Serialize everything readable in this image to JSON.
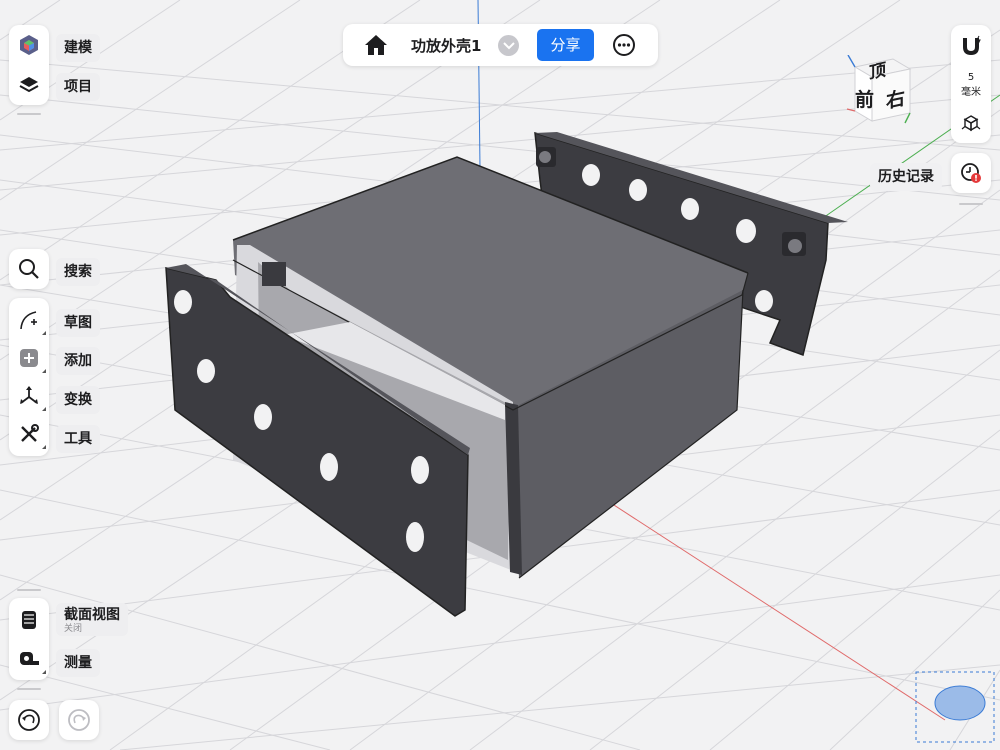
{
  "document": {
    "title": "功放外壳1",
    "share_label": "分享"
  },
  "sidebar_top": {
    "items": [
      {
        "label": "建模",
        "icon": "model-workspace-icon"
      },
      {
        "label": "项目",
        "icon": "layers-icon"
      }
    ]
  },
  "sidebar_tools": {
    "search": {
      "label": "搜索",
      "icon": "magnifier-icon"
    },
    "items": [
      {
        "label": "草图",
        "icon": "sketch-icon"
      },
      {
        "label": "添加",
        "icon": "add-icon"
      },
      {
        "label": "变换",
        "icon": "transform-icon"
      },
      {
        "label": "工具",
        "icon": "tools-icon"
      }
    ]
  },
  "sidebar_bottom": {
    "section_view": {
      "label": "截面视图",
      "status": "关闭",
      "icon": "section-view-icon"
    },
    "measure": {
      "label": "测量",
      "icon": "tape-measure-icon"
    }
  },
  "history": {
    "undo_icon": "undo-icon",
    "redo_icon": "redo-icon"
  },
  "right_panel": {
    "snap_icon": "magnet-icon",
    "snap_value": "5",
    "snap_unit": "毫米",
    "grid_icon": "cube-grid-icon",
    "history_label": "历史记录",
    "history_icon": "history-clock-icon"
  },
  "view_cube": {
    "top": "顶",
    "front": "前",
    "right": "右"
  },
  "colors": {
    "accent": "#1a73f0",
    "viewport_bg": "#f2f2f3",
    "grid": "#d8d8dc",
    "axis_y": "#3a7bd5",
    "axis_x": "#e06a6a",
    "axis_z": "#4caf50",
    "model_dark": "#3c3c41",
    "model_mid": "#5d5d63",
    "model_top": "#6e6e74"
  }
}
